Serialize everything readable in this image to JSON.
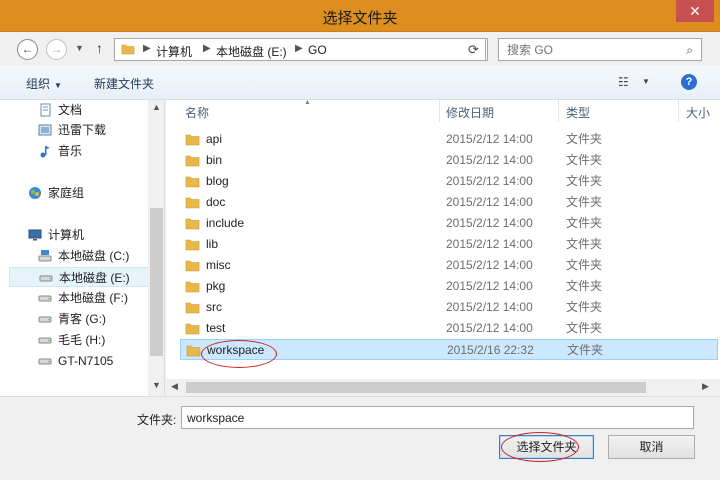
{
  "window": {
    "title": "选择文件夹",
    "close_label": "✕"
  },
  "address": {
    "crumbs": [
      "计算机",
      "本地磁盘 (E:)",
      "GO"
    ],
    "search_placeholder": "搜索 GO"
  },
  "toolbar": {
    "organize_label": "组织",
    "new_folder_label": "新建文件夹"
  },
  "nav": {
    "items": [
      {
        "label": "文档",
        "icon": "document-icon"
      },
      {
        "label": "迅雷下载",
        "icon": "download-folder-icon"
      },
      {
        "label": "音乐",
        "icon": "music-icon"
      },
      {
        "label": "家庭组",
        "icon": "homegroup-icon"
      },
      {
        "label": "计算机",
        "icon": "computer-icon"
      },
      {
        "label": "本地磁盘 (C:)",
        "icon": "system-drive-icon"
      },
      {
        "label": "本地磁盘 (E:)",
        "icon": "drive-icon",
        "selected": true
      },
      {
        "label": "本地磁盘 (F:)",
        "icon": "drive-icon"
      },
      {
        "label": "青客 (G:)",
        "icon": "drive-icon"
      },
      {
        "label": "毛毛 (H:)",
        "icon": "drive-icon"
      },
      {
        "label": "GT-N7105",
        "icon": "phone-device-icon"
      }
    ]
  },
  "columns": {
    "name": "名称",
    "date": "修改日期",
    "type": "类型",
    "size": "大小"
  },
  "files": [
    {
      "name": "api",
      "date": "2015/2/12 14:00",
      "type": "文件夹"
    },
    {
      "name": "bin",
      "date": "2015/2/12 14:00",
      "type": "文件夹"
    },
    {
      "name": "blog",
      "date": "2015/2/12 14:00",
      "type": "文件夹"
    },
    {
      "name": "doc",
      "date": "2015/2/12 14:00",
      "type": "文件夹"
    },
    {
      "name": "include",
      "date": "2015/2/12 14:00",
      "type": "文件夹"
    },
    {
      "name": "lib",
      "date": "2015/2/12 14:00",
      "type": "文件夹"
    },
    {
      "name": "misc",
      "date": "2015/2/12 14:00",
      "type": "文件夹"
    },
    {
      "name": "pkg",
      "date": "2015/2/12 14:00",
      "type": "文件夹"
    },
    {
      "name": "src",
      "date": "2015/2/12 14:00",
      "type": "文件夹"
    },
    {
      "name": "test",
      "date": "2015/2/12 14:00",
      "type": "文件夹"
    },
    {
      "name": "workspace",
      "date": "2015/2/16 22:32",
      "type": "文件夹",
      "selected": true
    }
  ],
  "bottom": {
    "folder_label": "文件夹:",
    "folder_value": "workspace",
    "select_button": "选择文件夹",
    "cancel_button": "取消"
  },
  "colors": {
    "titlebar": "#dd8e1f",
    "selection": "#cce8ff",
    "annotation": "#cc2222"
  }
}
